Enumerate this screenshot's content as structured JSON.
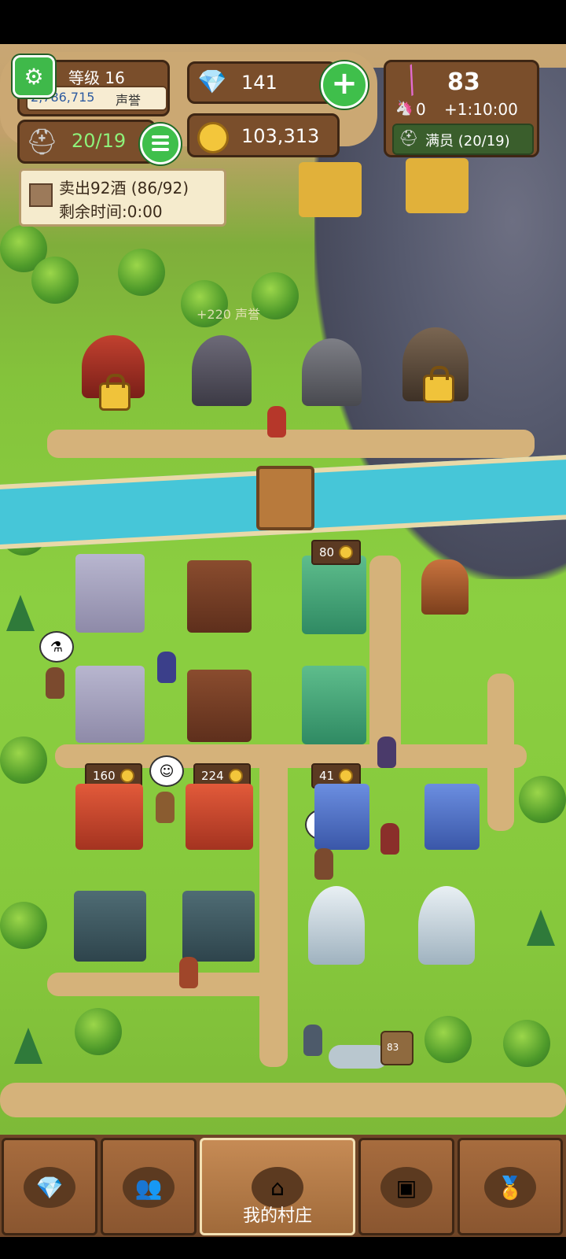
{
  "hud": {
    "level": "等级 16",
    "reputation_value": "2,786,715",
    "reputation_label": "声誉",
    "gems": "141",
    "gold": "103,313",
    "heroes": "20/19",
    "candy": "83",
    "unicorn_count": "0",
    "timer": "+1:10:00",
    "capacity_label": "满员 (20/19)"
  },
  "quest": {
    "line1": "卖出92酒 (86/92)",
    "line2": "剩余时间:0:00"
  },
  "map": {
    "floating_text": "+220 声誉",
    "price_tags": [
      "80",
      "160",
      "224",
      "41"
    ],
    "crate_label": "83"
  },
  "bottom_nav": {
    "tabs": [
      {
        "icon": "gem-icon",
        "label": ""
      },
      {
        "icon": "group-icon",
        "label": ""
      },
      {
        "icon": "house-icon",
        "label": "我的村庄"
      },
      {
        "icon": "chest-icon",
        "label": ""
      },
      {
        "icon": "medal-icon",
        "label": ""
      }
    ]
  },
  "colors": {
    "panel_brown": "#7a4e2b",
    "accent_green": "#3fbf4b",
    "grass": "#86c83c",
    "river": "#46c6d8"
  }
}
